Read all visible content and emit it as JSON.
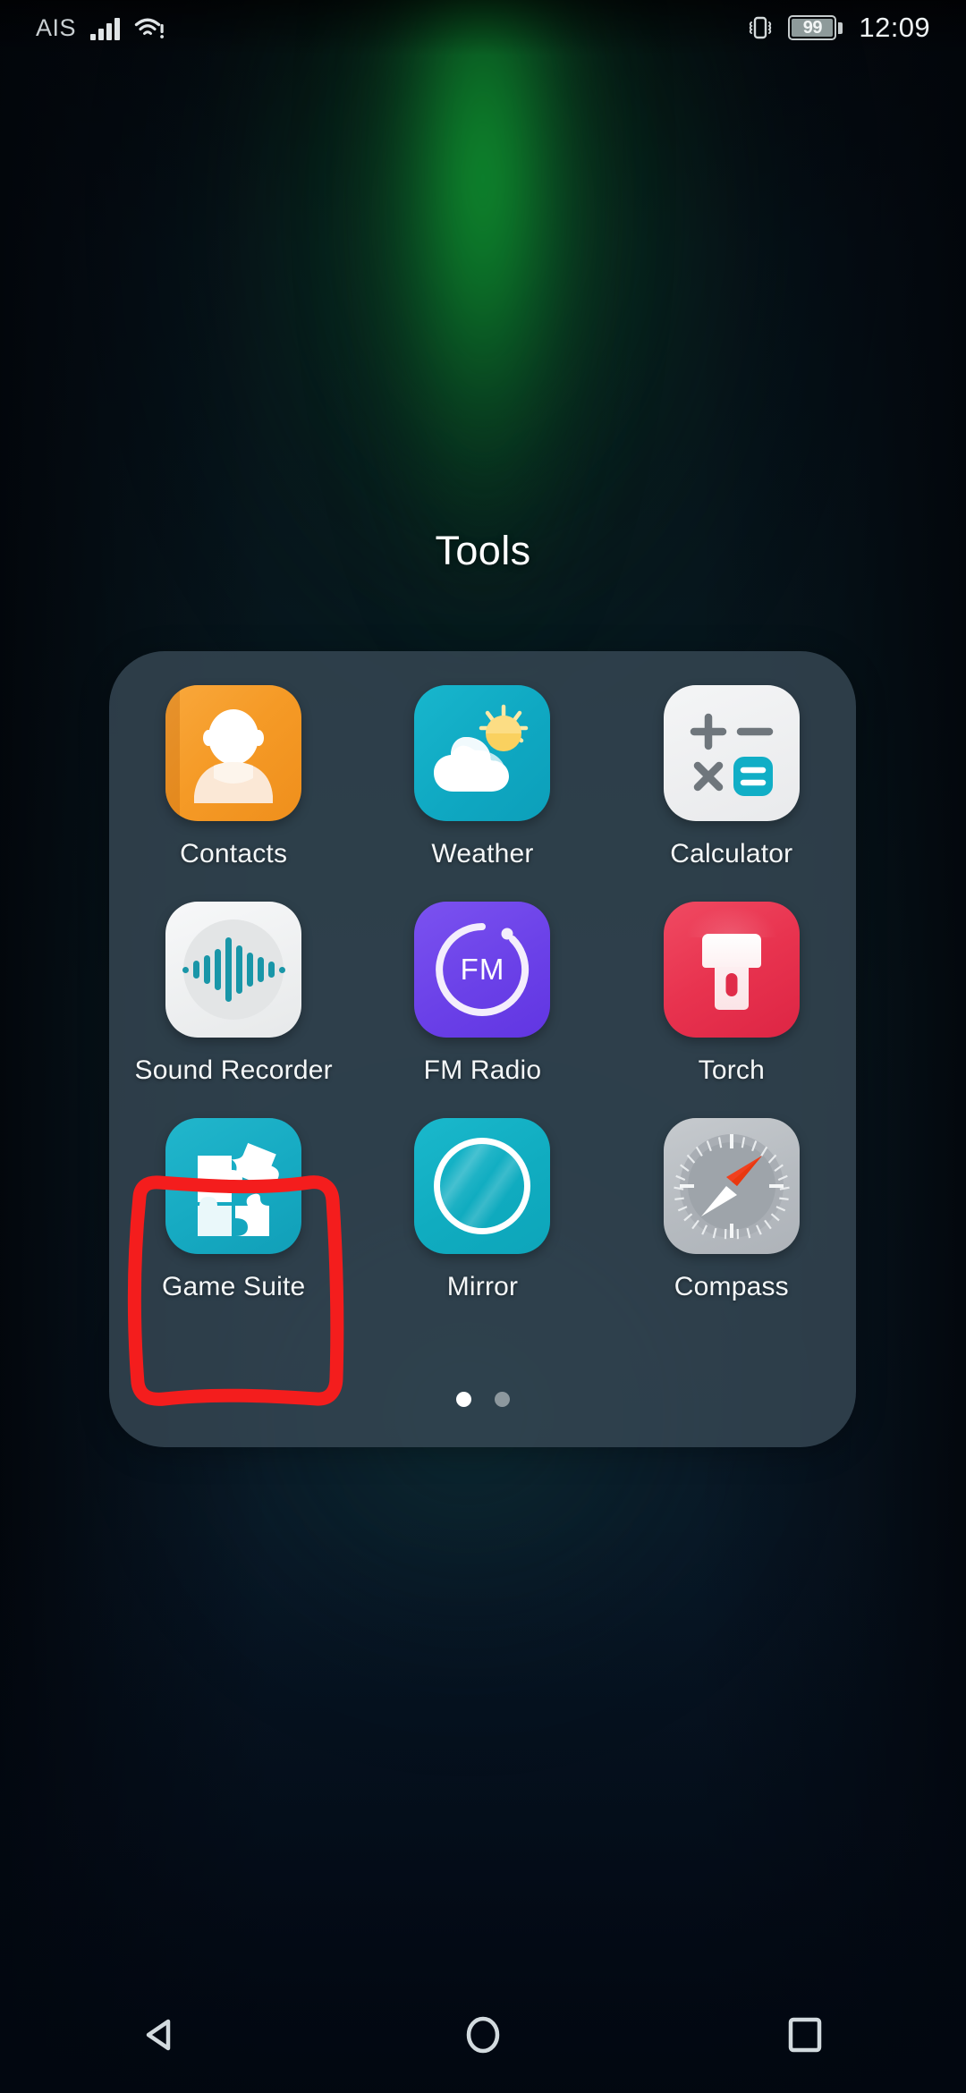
{
  "status_bar": {
    "carrier": "AIS",
    "signal_icon": "signal-bars-icon",
    "signal_strength": 4,
    "wifi_icon": "wifi-warning-icon",
    "vibrate_icon": "vibrate-icon",
    "battery_percent": "99",
    "battery_icon": "battery-icon",
    "clock": "12:09"
  },
  "folder": {
    "title": "Tools",
    "apps": [
      {
        "label": "Contacts",
        "icon": "contacts-icon",
        "color": "#f59a26"
      },
      {
        "label": "Weather",
        "icon": "weather-icon",
        "color": "#0fa8c2"
      },
      {
        "label": "Calculator",
        "icon": "calculator-icon",
        "color": "#e9eaec"
      },
      {
        "label": "Sound Recorder",
        "icon": "sound-recorder-icon",
        "color": "#e7e9ea"
      },
      {
        "label": "FM Radio",
        "icon": "fm-radio-icon",
        "color": "#6b41e8"
      },
      {
        "label": "Torch",
        "icon": "torch-icon",
        "color": "#e8334f"
      },
      {
        "label": "Game Suite",
        "icon": "game-suite-icon",
        "color": "#16aac2"
      },
      {
        "label": "Mirror",
        "icon": "mirror-icon",
        "color": "#10acc0"
      },
      {
        "label": "Compass",
        "icon": "compass-icon",
        "color": "#b6bbc0"
      }
    ],
    "fm_badge_text": "FM",
    "calculator_symbols": {
      "plus": "+",
      "minus": "−",
      "multiply": "×",
      "equals": "="
    },
    "pages": {
      "count": 2,
      "active_index": 0
    }
  },
  "annotation": {
    "shape": "hand-drawn-rectangle",
    "color": "#f41d1d",
    "target_app": "Game Suite"
  },
  "nav_bar": {
    "back_icon": "back-triangle-icon",
    "home_icon": "home-circle-icon",
    "recents_icon": "recents-square-icon"
  },
  "wallpaper": {
    "description": "dark aurora wallpaper",
    "base_color": "#061018",
    "accent_color": "#109630"
  }
}
